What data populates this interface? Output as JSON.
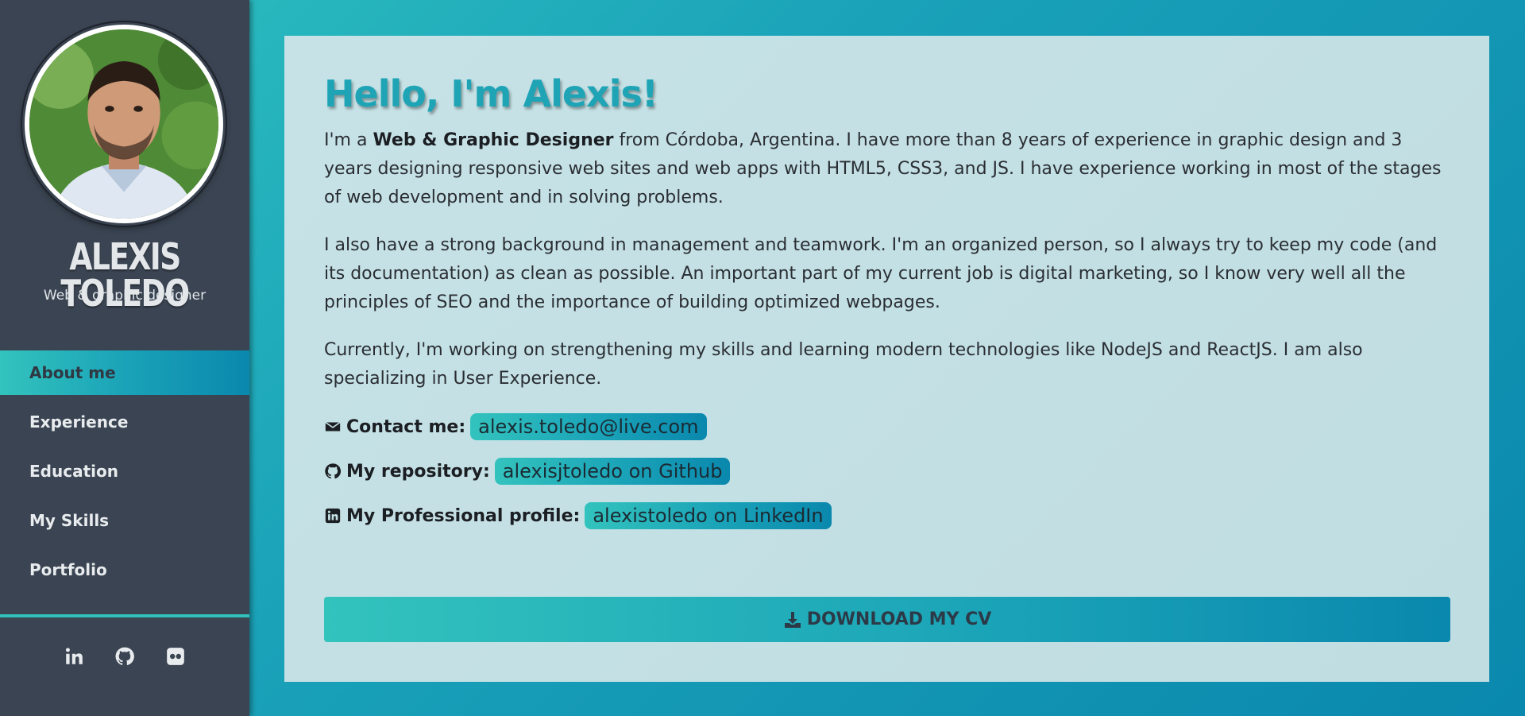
{
  "sidebar": {
    "name": "ALEXIS TOLEDO",
    "role": "Web & graphic designer",
    "nav": [
      {
        "label": "About me"
      },
      {
        "label": "Experience"
      },
      {
        "label": "Education"
      },
      {
        "label": "My Skills"
      },
      {
        "label": "Portfolio"
      }
    ],
    "active_index": 0,
    "social": [
      "linkedin-icon",
      "github-icon",
      "flickr-icon"
    ]
  },
  "main": {
    "greeting": "Hello, I'm Alexis!",
    "paragraph1": {
      "prefix": "I'm a ",
      "bold": "Web & Graphic Designer",
      "suffix": " from Córdoba, Argentina. I have more than 8 years of experience in graphic design and 3 years designing responsive web sites and web apps with HTML5, CSS3, and JS. I have experience working in most of the stages of web development and in solving problems."
    },
    "paragraph2": "I also have a strong background in management and teamwork. I'm an organized person, so I always try to keep my code (and its documentation) as clean as possible. An important part of my current job is digital marketing, so I know very well all the principles of SEO and the importance of building optimized webpages.",
    "paragraph3": "Currently, I'm working on strengthening my skills and learning modern technologies like NodeJS and ReactJS. I am also specializing in User Experience.",
    "contacts": [
      {
        "icon": "envelope-icon",
        "label": "Contact me:",
        "value": "alexis.toledo@live.com"
      },
      {
        "icon": "github-icon",
        "label": "My repository:",
        "value": "alexisjtoledo on Github"
      },
      {
        "icon": "linkedin-icon",
        "label": "My Professional profile:",
        "value": "alexistoledo on LinkedIn"
      }
    ],
    "download_label": "DOWNLOAD MY CV"
  },
  "colors": {
    "accent_start": "#33c3bd",
    "accent_end": "#0a88ad",
    "sidebar_bg": "#3a4452",
    "card_bg": "#c4e0e4",
    "greeting": "#1fa4b6"
  }
}
